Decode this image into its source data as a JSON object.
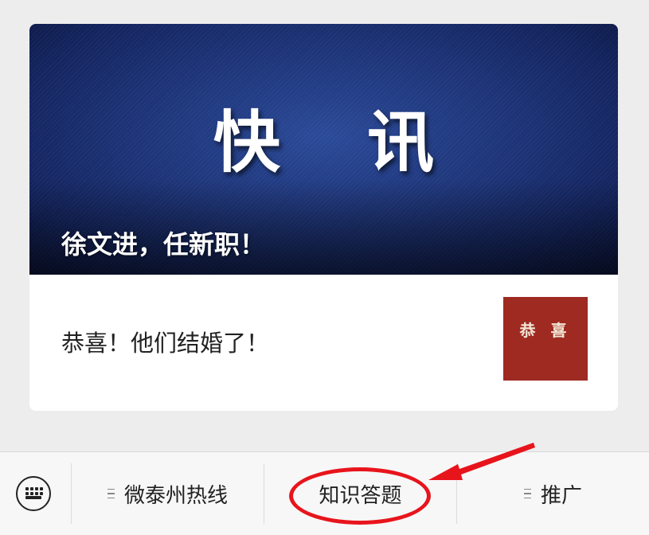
{
  "article_card": {
    "hero_title": "快 讯",
    "hero_headline": "徐文进，任新职！",
    "item_title": "恭喜！他们结婚了！",
    "thumbnail_text": "恭 喜"
  },
  "menu_bar": {
    "keyboard_icon": "keyboard-icon",
    "items": [
      {
        "label": "微泰州热线",
        "has_submenu": true
      },
      {
        "label": "知识答题",
        "has_submenu": false
      },
      {
        "label": "推广",
        "has_submenu": true
      }
    ]
  },
  "annotation": {
    "color": "#e8141c"
  }
}
